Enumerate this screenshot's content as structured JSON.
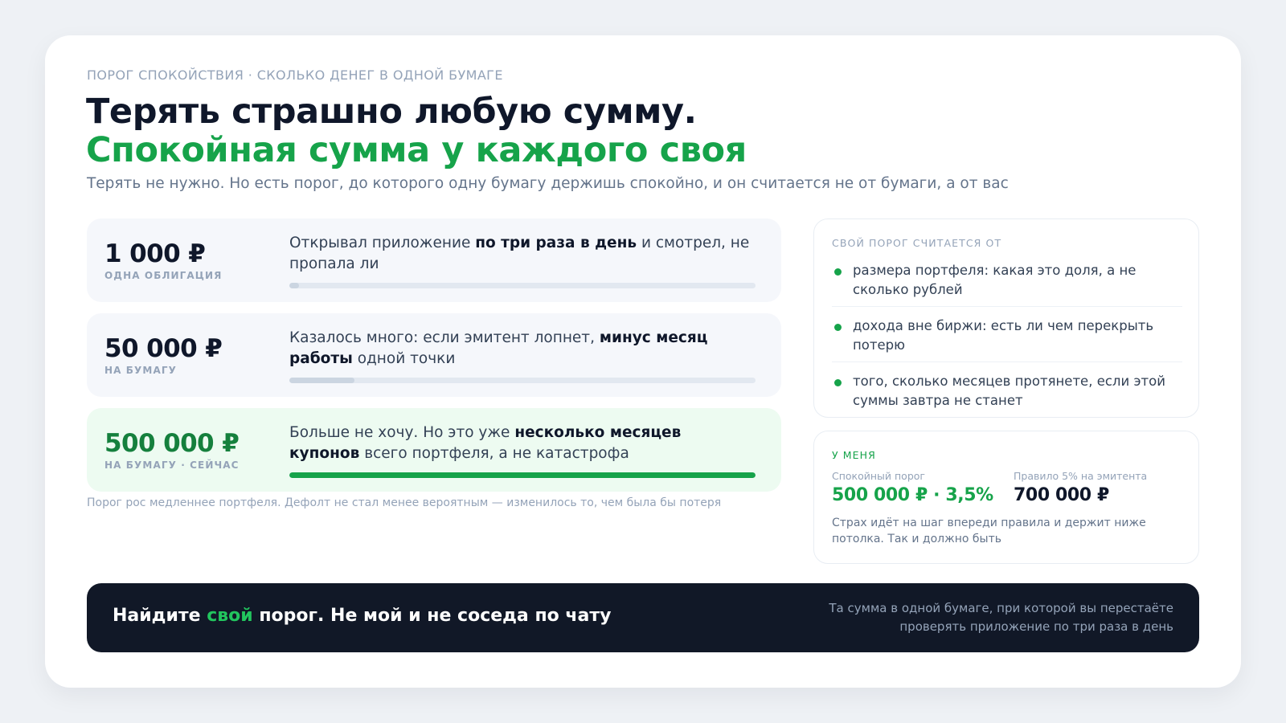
{
  "eyebrow": "ПОРОГ СПОКОЙСТВИЯ · СКОЛЬКО ДЕНЕГ В ОДНОЙ БУМАГЕ",
  "title_line1": "Терять страшно любую сумму.",
  "title_line2": "Спокойная сумма у каждого своя",
  "subtitle": "Терять не нужно. Но есть порог, до которого одну бумагу держишь спокойно, и он считается не от бумаги, а от вас",
  "rows": [
    {
      "amount": "1 000 ₽",
      "label": "ОДНА ОБЛИГАЦИЯ",
      "desc_before": "Открывал приложение ",
      "desc_bold": "по три раза в день",
      "desc_after": " и смотрел, не пропала ли",
      "bar_fraction": 0.02
    },
    {
      "amount": "50 000 ₽",
      "label": "НА БУМАГУ",
      "desc_before": "Казалось много: если эмитент лопнет, ",
      "desc_bold": "минус месяц работы",
      "desc_after": " одной точки",
      "bar_fraction": 0.14
    },
    {
      "amount": "500 000 ₽",
      "label": "НА БУМАГУ · СЕЙЧАС",
      "desc_before": "Больше не хочу. Но это уже ",
      "desc_bold": "несколько месяцев купонов",
      "desc_after": " всего портфеля, а не катастрофа",
      "bar_fraction": 1.0
    }
  ],
  "footnote": "Порог рос медленнее портфеля. Дефолт не стал менее вероятным — изменилось то, чем была бы потеря",
  "factors": {
    "heading": "СВОЙ ПОРОГ СЧИТАЕТСЯ ОТ",
    "items": [
      "размера портфеля: какая это доля, а не сколько рублей",
      "дохода вне биржи: есть ли чем перекрыть потерю",
      "того, сколько месяцев протянете, если этой суммы завтра не станет"
    ]
  },
  "mine": {
    "heading": "У МЕНЯ",
    "stat1_label": "Спокойный порог",
    "stat1_value": "500 000 ₽ · 3,5%",
    "stat2_label": "Правило 5% на эмитента",
    "stat2_value": "700 000 ₽",
    "note": "Страх идёт на шаг впереди правила и держит ниже потолка. Так и должно быть"
  },
  "banner": {
    "text_before": "Найдите ",
    "text_accent": "свой",
    "text_after": " порог. Не мой и не соседа по чату",
    "note": "Та сумма в одной бумаге, при которой вы перестаёте проверять приложение по три раза в день"
  },
  "colors": {
    "accent": "#16a34a",
    "dark": "#111827",
    "muted": "#94a3b8",
    "current_row_bg": "#edfbf1"
  }
}
